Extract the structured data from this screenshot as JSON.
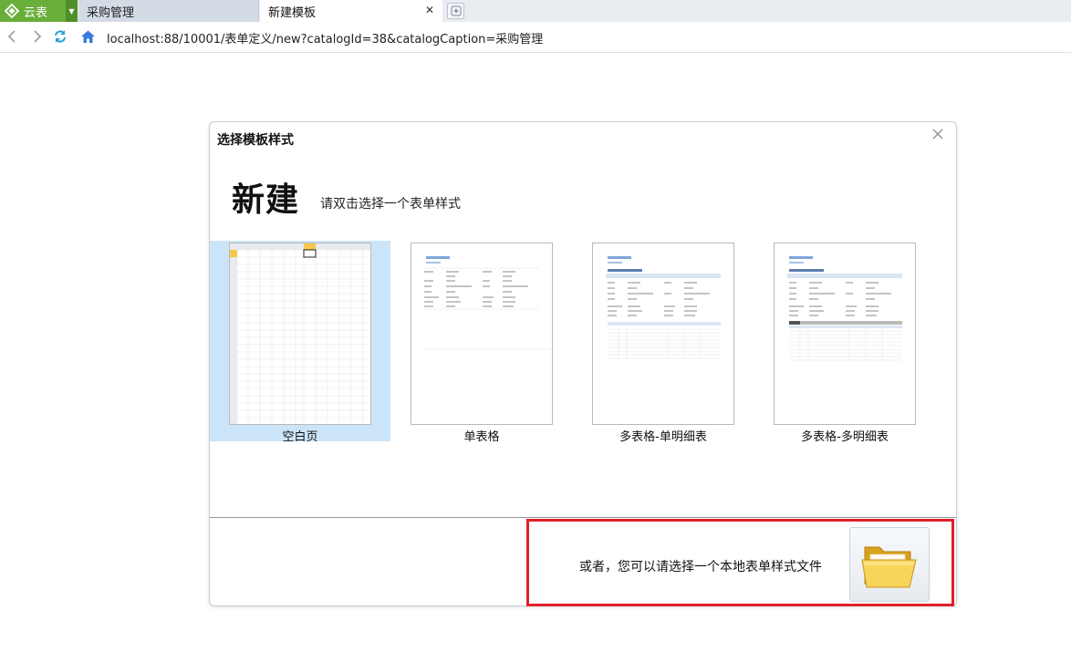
{
  "browser": {
    "app_name": "云表",
    "tabs": [
      {
        "label": "采购管理",
        "active": false
      },
      {
        "label": "新建模板",
        "active": true
      }
    ],
    "url": "localhost:88/10001/表单定义/new?catalogId=38&catalogCaption=采购管理",
    "accent_color": "#6aae3a"
  },
  "dialog": {
    "title": "选择模板样式",
    "heading": "新建",
    "subheading": "请双击选择一个表单样式",
    "templates": [
      {
        "label": "空白页",
        "selected": true
      },
      {
        "label": "单表格",
        "selected": false
      },
      {
        "label": "多表格-单明细表",
        "selected": false
      },
      {
        "label": "多表格-多明细表",
        "selected": false
      }
    ],
    "local_file_text": "或者，您可以请选择一个本地表单样式文件",
    "folder_icon": "folder-icon",
    "highlight_color": "#e0202a"
  }
}
